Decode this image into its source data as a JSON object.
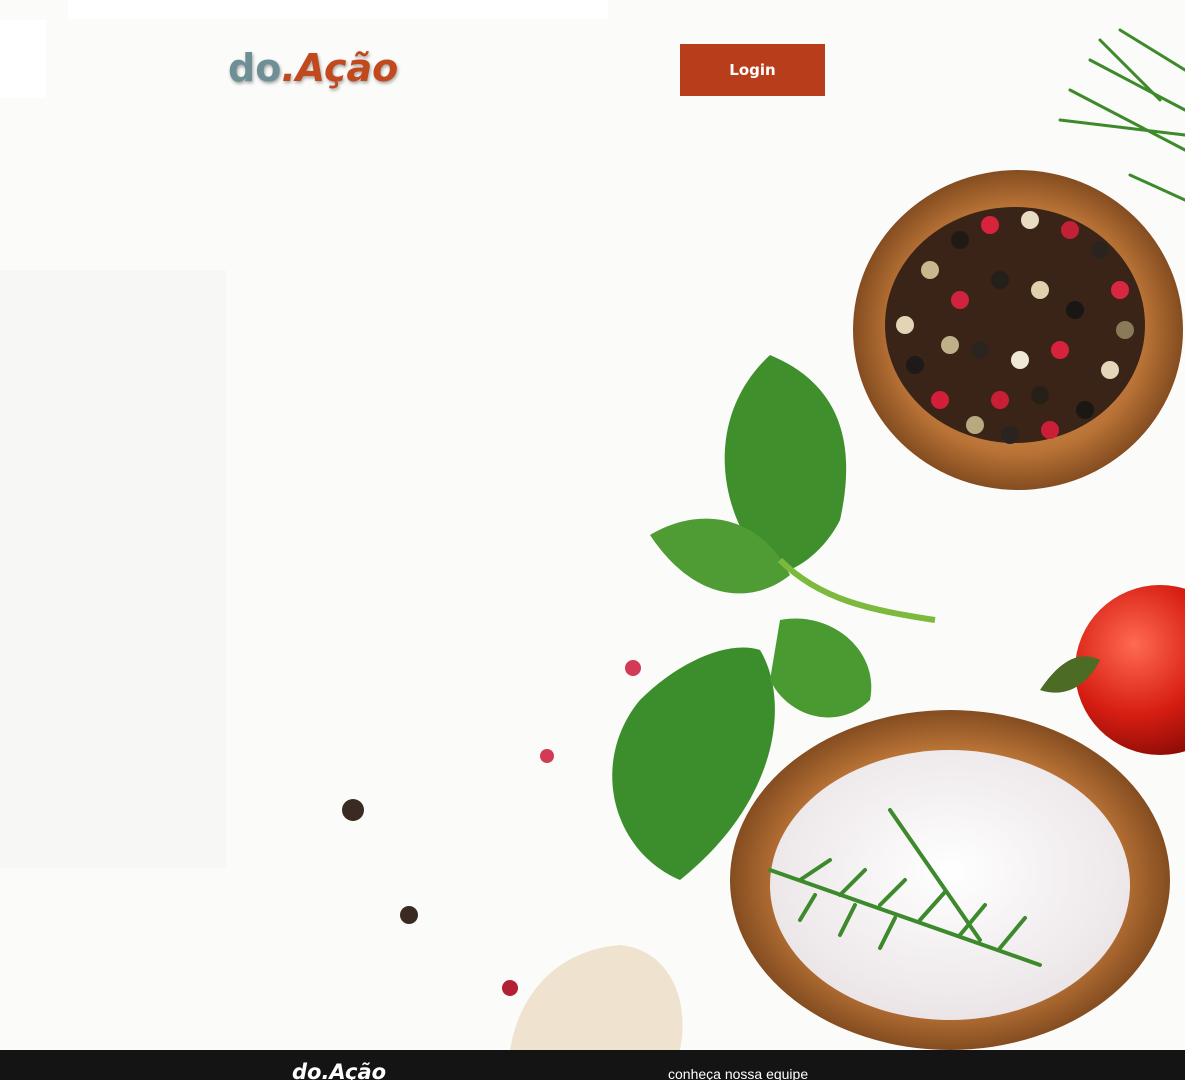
{
  "header": {
    "logo_part1": "do",
    "logo_part2": ".Ação",
    "login_label": "Login"
  },
  "hero": {
    "image_icon": "food-spices-photo"
  },
  "footer": {
    "logo": "do.Ação",
    "team_link": "conheça nossa equipe"
  },
  "colors": {
    "accent": "#b83e1b",
    "logo_gray": "#6e8f96",
    "footer_bg": "#141414"
  }
}
